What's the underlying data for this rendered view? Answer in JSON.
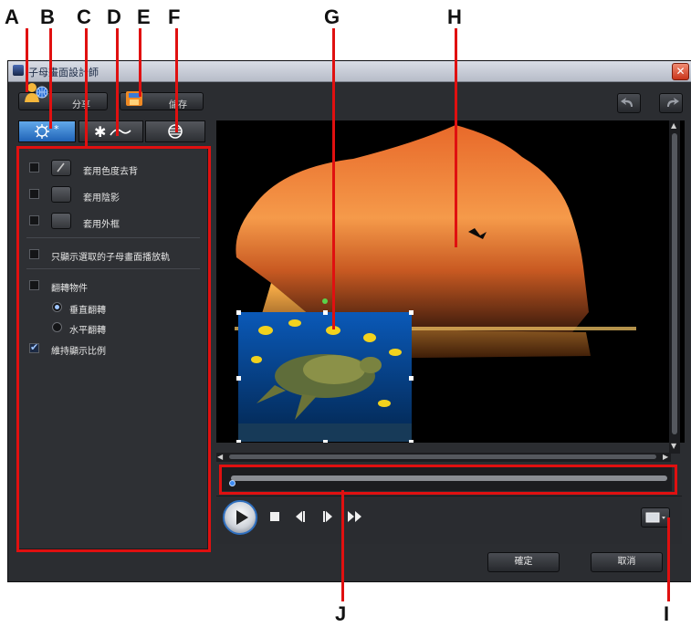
{
  "window": {
    "title": "子母畫面設計師",
    "close_symbol": "✕"
  },
  "toolbar": {
    "share_label": "分享",
    "save_label": "儲存"
  },
  "options": {
    "chroma_key": "套用色度去背",
    "shadow": "套用陰影",
    "border": "套用外框",
    "show_selected_path": "只顯示選取的子母畫面播放軌",
    "flip_object": "翻轉物件",
    "flip_vertical": "垂直翻轉",
    "flip_horizontal": "水平翻轉",
    "keep_aspect": "維持顯示比例",
    "keep_aspect_checked": true,
    "flip_vertical_selected": true
  },
  "footer": {
    "ok_label": "確定",
    "cancel_label": "取消"
  },
  "callouts": [
    "A",
    "B",
    "C",
    "D",
    "E",
    "F",
    "G",
    "H",
    "I",
    "J"
  ],
  "colors": {
    "annotation": "#e01010",
    "tab_active": "#1f63b7",
    "window_bg": "#2b2d31"
  }
}
